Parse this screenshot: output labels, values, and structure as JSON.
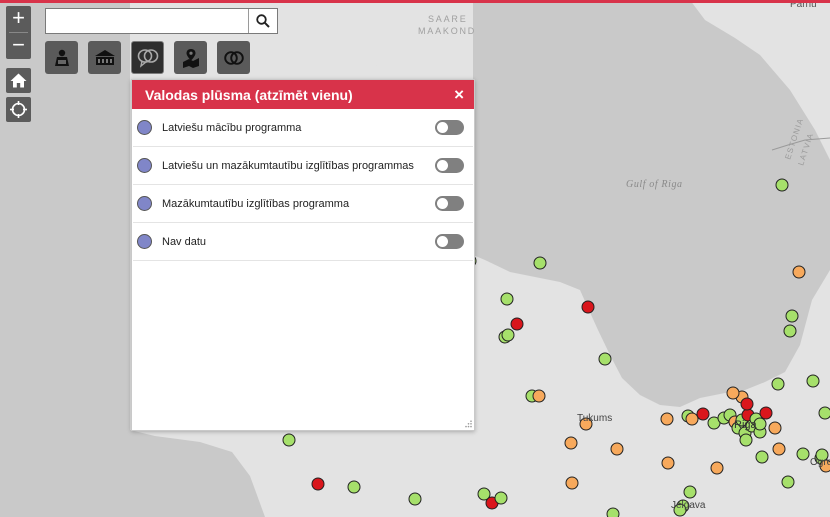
{
  "map": {
    "labels": {
      "saare": "SAARE",
      "maakond": "MAAKOND",
      "gulf": "Gulf of Riga",
      "estonia": "ESTONIA",
      "latvia": "LATVIA",
      "parnu": "Parnu",
      "tukums": "Tukums",
      "riga": "Riga",
      "jelgava": "Jelgava",
      "ogre": "Ogre"
    },
    "colors": {
      "green": "#a6e06b",
      "orange": "#f7a95c",
      "red": "#d9161c",
      "land": "#e3e3e3",
      "water": "#c9c9c9"
    }
  },
  "controls": {
    "zoom_in": "+",
    "zoom_out": "−",
    "home_icon": "home-icon",
    "locate_icon": "locate-crosshair-icon"
  },
  "search": {
    "value": "",
    "placeholder": "",
    "icon": "search-icon"
  },
  "toolbar": [
    {
      "icon": "student-icon",
      "active": false
    },
    {
      "icon": "school-building-icon",
      "active": false
    },
    {
      "icon": "speech-bubbles-icon",
      "active": true
    },
    {
      "icon": "map-location-icon",
      "active": false
    },
    {
      "icon": "interlocking-rings-icon",
      "active": false
    }
  ],
  "panel": {
    "title": "Valodas plūsma (atzīmēt vienu)",
    "close": "×",
    "marker_color": "#8086c8",
    "items": [
      {
        "label": "Latviešu mācību programma",
        "on": false
      },
      {
        "label": "Latviešu un mazākumtautību izglītības programmas",
        "on": false
      },
      {
        "label": "Mazākumtautību izglītības programma",
        "on": false
      },
      {
        "label": "Nav datu",
        "on": false
      }
    ]
  }
}
